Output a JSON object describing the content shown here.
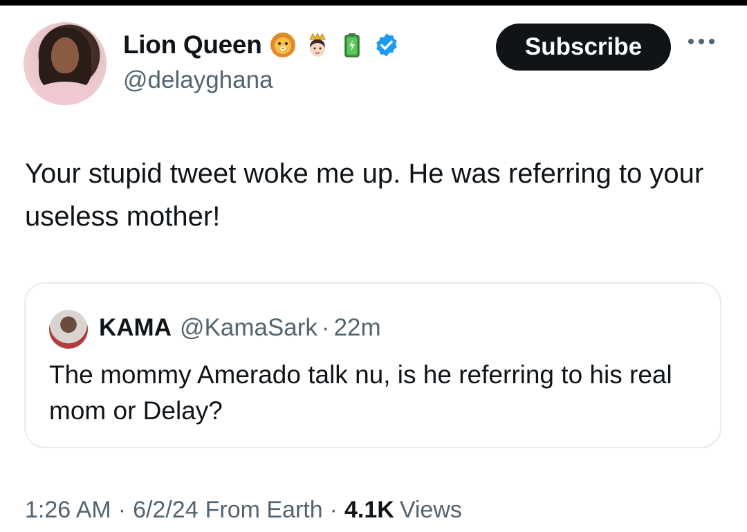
{
  "author": {
    "name": "Lion Queen",
    "handle": "@delayghana",
    "badges": [
      "lion-face-emoji",
      "princess-emoji",
      "battery-emoji",
      "verified-badge-icon"
    ]
  },
  "actions": {
    "subscribe_label": "Subscribe",
    "more_icon": "more-horizontal-icon"
  },
  "tweet": {
    "text": "Your stupid tweet woke me up. He was referring to your useless mother!"
  },
  "quoted": {
    "name": "KAMA",
    "handle": "@KamaSark",
    "separator": "·",
    "time": "22m",
    "text": "The mommy Amerado talk nu, is he referring to his real mom or Delay?"
  },
  "meta": {
    "time": "1:26 AM",
    "date": "6/2/24",
    "location": "From Earth",
    "views_count": "4.1K",
    "views_label": "Views",
    "separator": "·"
  },
  "colors": {
    "text_primary": "#0f1419",
    "text_secondary": "#536471",
    "verified_blue": "#1d9bf0",
    "border": "#e6ebee"
  }
}
